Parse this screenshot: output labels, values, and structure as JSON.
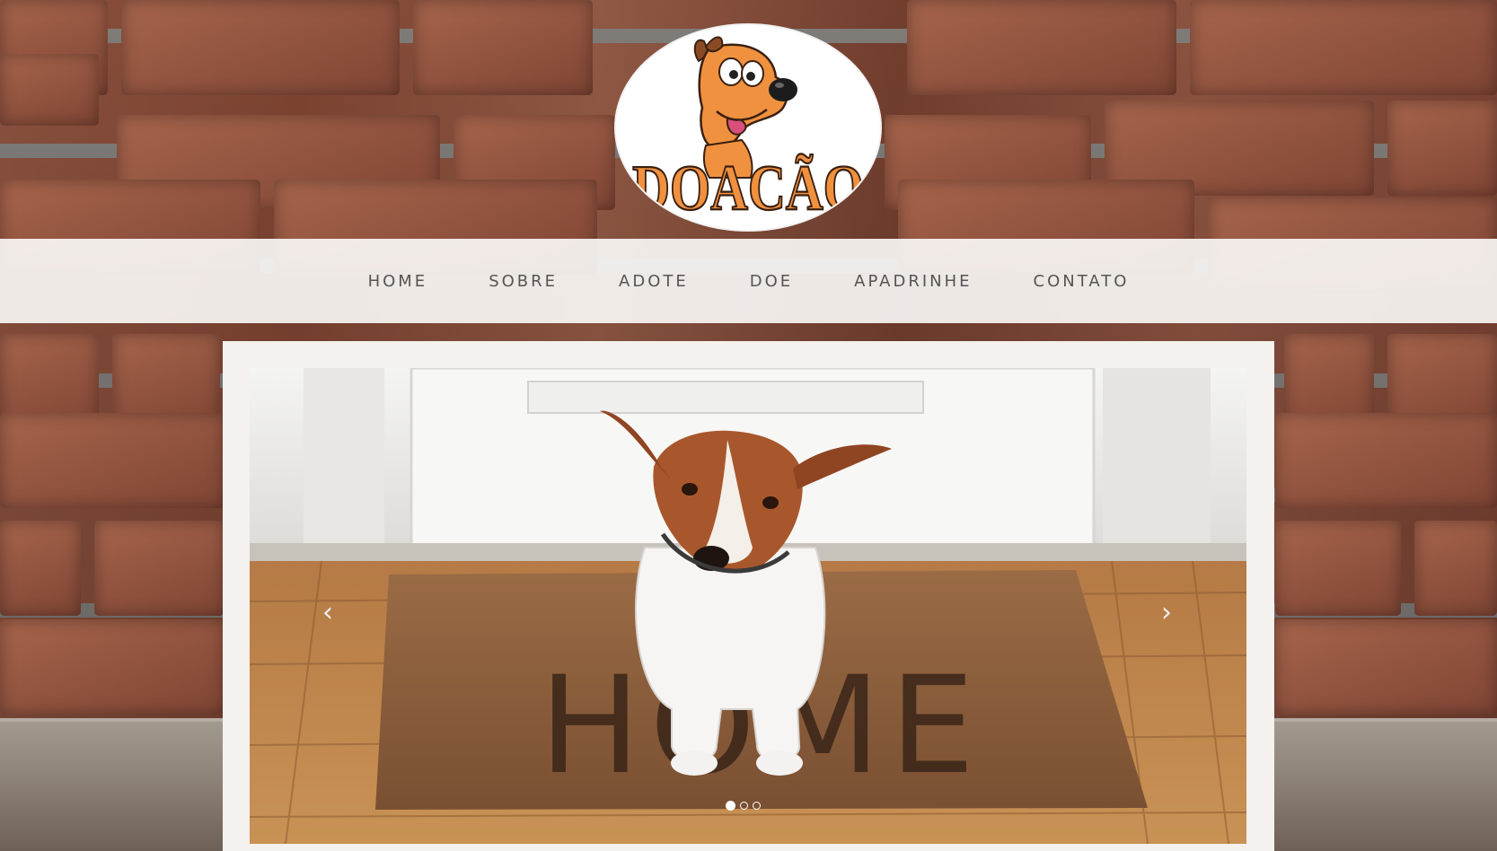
{
  "logo": {
    "text": "DOACÃO",
    "icon": "cartoon-dog-logo"
  },
  "nav": {
    "items": [
      {
        "label": "HOME"
      },
      {
        "label": "SOBRE"
      },
      {
        "label": "ADOTE"
      },
      {
        "label": "DOE"
      },
      {
        "label": "APADRINHE"
      },
      {
        "label": "CONTATO"
      }
    ]
  },
  "carousel": {
    "prev_label": "‹",
    "next_label": "›",
    "slide_image": "dog-sitting-on-home-doormat",
    "doormat_text": "HOME",
    "active_index": 0,
    "slide_count": 3
  },
  "colors": {
    "logo_orange": "#f0913f",
    "nav_text": "#555555",
    "nav_bg": "#f7f5f3"
  }
}
